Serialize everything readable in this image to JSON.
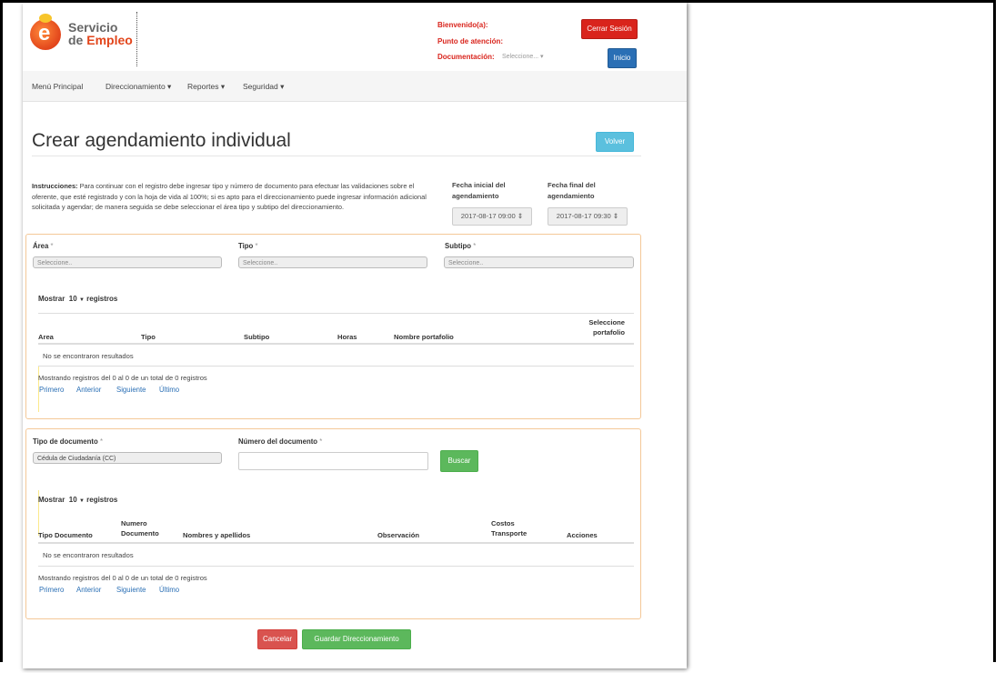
{
  "brand": {
    "line1": "Servicio",
    "line2_prefix": "de ",
    "line2_brand": "Empleo",
    "logo_letter": "e"
  },
  "header": {
    "welcome_label": "Bienvenido(a):",
    "attention_label": "Punto de atención:",
    "doc_label": "Documentación:",
    "doc_select_value": "Seleccione...",
    "logout_label": "Cerrar Sesión",
    "home_label": "Inicio"
  },
  "nav": {
    "items": [
      {
        "label": "Menú Principal"
      },
      {
        "label": "Direccionamiento"
      },
      {
        "label": "Reportes"
      },
      {
        "label": "Seguridad"
      }
    ]
  },
  "page": {
    "title": "Crear agendamiento individual",
    "back_label": "Volver",
    "instructions_bold": "Instrucciones:",
    "instructions_text": " Para continuar con el registro debe ingresar tipo y número de documento para efectuar las validaciones sobre el oferente, que esté registrado y con la hoja de vida al 100%; si es apto para el direccionamiento puede ingresar información adicional solicitada y agendar; de manera seguida se debe seleccionar el área tipo y subtipo del direccionamiento.",
    "fecha_inicial_label_1": "Fecha inicial del",
    "fecha_inicial_label_2": "agendamiento",
    "fecha_inicial_value": "2017-08-17 09:00",
    "fecha_final_label_1": "Fecha final del",
    "fecha_final_label_2": "agendamiento",
    "fecha_final_value": "2017-08-17 09:30"
  },
  "portfolio_panel": {
    "area_label": "Área",
    "tipo_label": "Tipo",
    "subtipo_label": "Subtipo",
    "required_mark": "*",
    "select_placeholder": "Seleccione..",
    "show_prefix": "Mostrar",
    "show_value": "10",
    "show_suffix": "registros",
    "columns": [
      "Area",
      "Tipo",
      "Subtipo",
      "Horas",
      "Nombre portafolio",
      "Seleccione",
      "portafolio"
    ],
    "empty_text": "No se encontraron resultados",
    "info_text": "Mostrando registros del 0 al 0 de un total de 0 registros",
    "pagination": [
      "Primero",
      "Anterior",
      "Siguiente",
      "Último"
    ]
  },
  "document_panel": {
    "doc_type_label": "Tipo de documento",
    "doc_type_value": "Cédula de Ciudadanía (CC)",
    "doc_number_label": "Número del documento",
    "required_mark": "*",
    "search_label": "Buscar",
    "show_prefix": "Mostrar",
    "show_value": "10",
    "show_suffix": "registros",
    "columns": [
      "Tipo Documento",
      "Numero",
      "Documento",
      "Nombres y apellidos",
      "Observación",
      "Costos",
      "Transporte",
      "Acciones"
    ],
    "empty_text": "No se encontraron resultados",
    "info_text": "Mostrando registros del 0 al 0 de un total de 0 registros",
    "pagination": [
      "Primero",
      "Anterior",
      "Siguiente",
      "Último"
    ]
  },
  "footer": {
    "cancel_label": "Cancelar",
    "save_label": "Guardar Direccionamiento"
  }
}
